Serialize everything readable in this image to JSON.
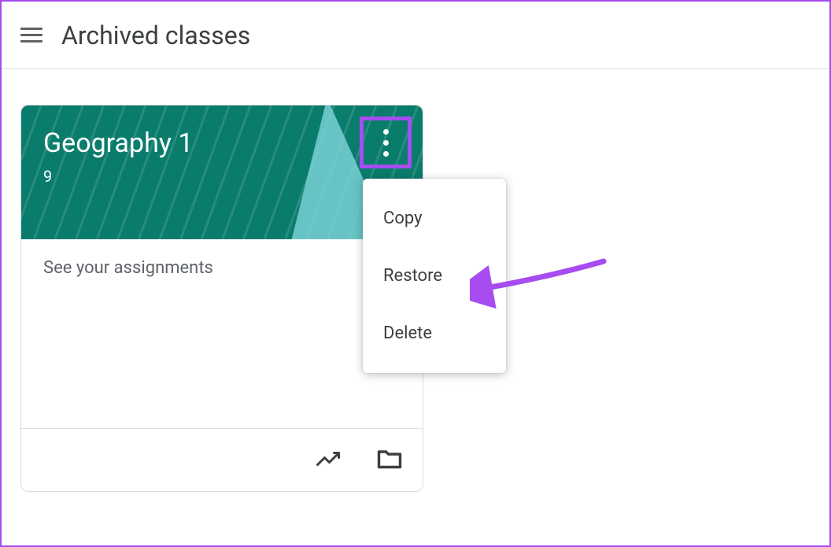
{
  "header": {
    "title": "Archived classes"
  },
  "class_card": {
    "name": "Geography 1",
    "section": "9",
    "body_text": "See your assignments"
  },
  "menu": {
    "items": [
      "Copy",
      "Restore",
      "Delete"
    ]
  }
}
